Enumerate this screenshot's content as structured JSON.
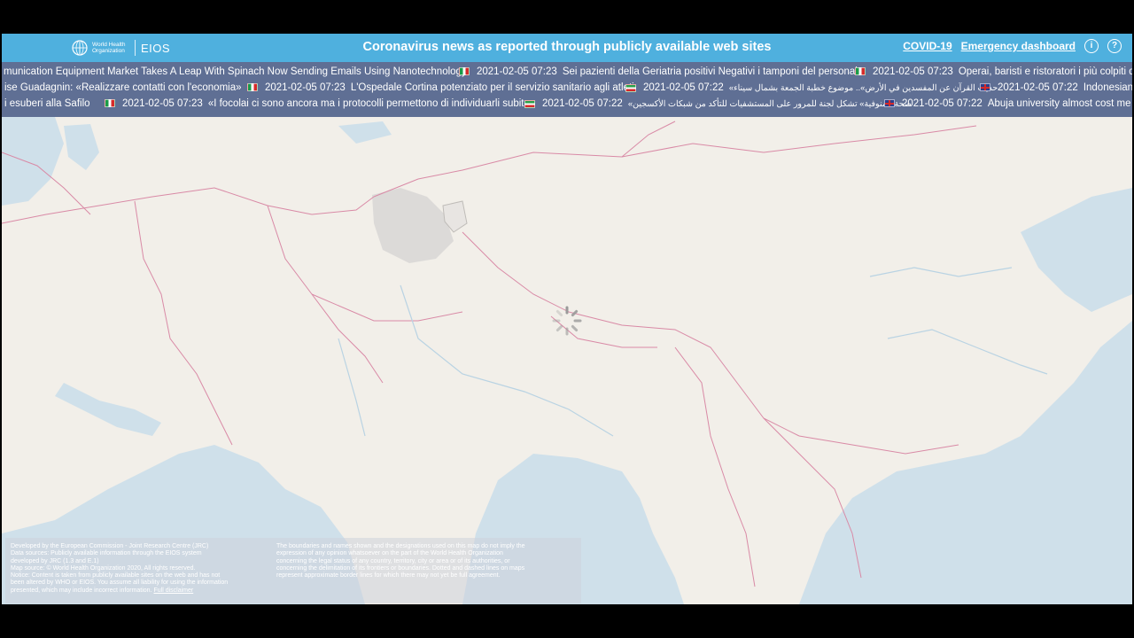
{
  "header": {
    "logo_org": "World Health Organization",
    "logo_product": "EIOS",
    "title": "Coronavirus news as reported through publicly available web sites",
    "nav": {
      "covid_link": "COVID-19",
      "emergency_link": "Emergency dashboard",
      "info_icon": "info-icon",
      "help_icon": "help-icon"
    },
    "color": "#4fb0de"
  },
  "ticker": {
    "color": "#5f6f94",
    "rows": [
      [
        {
          "flag": "",
          "time": "",
          "text": "munication Equipment Market Takes A Leap With Spinach Now Sending Emails Using Nanotechnology"
        },
        {
          "flag": "it",
          "time": "2021-02-05 07:23",
          "text": "Sei pazienti della Geriatria positivi Negativi i tamponi del personale"
        },
        {
          "flag": "it",
          "time": "2021-02-05 07:23",
          "text": "Operai, baristi e ristoratori i più colpiti dalla"
        }
      ],
      [
        {
          "flag": "",
          "time": "",
          "text": "ise Guadagnin: «Realizzare contatti con l'economia»"
        },
        {
          "flag": "it",
          "time": "2021-02-05 07:23",
          "text": "L'Ospedale Cortina potenziato per il servizio sanitario agli atleti"
        },
        {
          "flag": "ir",
          "time": "2021-02-05 07:22",
          "text": "حديث القرآن عن المفسدين في الأرض».. موضوع خطبة الجمعة بشمال سيناء»"
        },
        {
          "flag": "gb",
          "time": "2021-02-05 07:22",
          "text": "Indonesian e"
        }
      ],
      [
        {
          "flag": "",
          "time": "",
          "text": "i esuberi alla Safilo"
        },
        {
          "flag": "it",
          "time": "2021-02-05 07:23",
          "text": "«I focolai ci sono ancora ma i protocolli permettono di individuarli subito»"
        },
        {
          "flag": "ir",
          "time": "2021-02-05 07:22",
          "text": "صحة المنوفية» تشكل لجنة للمرور على المستشفيات للتأكد من شبكات الأكسجين»"
        },
        {
          "flag": "gb",
          "time": "2021-02-05 07:22",
          "text": "Abuja university almost cost me my"
        }
      ]
    ]
  },
  "map": {
    "loading_icon": "loading-spinner-icon",
    "land_color": "#f2efe9",
    "water_color": "#cfe0ea",
    "border_color": "#d98aa6"
  },
  "disclaimer": {
    "left_lines": [
      "Developed by the European Commission - Joint Research Centre (JRC)",
      "Data sources: Publicly available information through the EIOS system",
      "developed by JRC (1.3 and E.1)",
      "Map source: © World Health Organization 2020, All rights reserved.",
      "Notice: Content is taken from publicly available sites on the web and has not",
      "been altered by WHO or EIOS. You assume all liability for using the information",
      "presented, which may include incorrect information."
    ],
    "link": "Full disclaimer",
    "right_lines": [
      "The boundaries and names shown and the designations used on this map do not imply the",
      "expression of any opinion whatsoever on the part of the World Health Organization",
      "concerning the legal status of any country, territory, city or area or of its authorities, or",
      "concerning the delimitation of its frontiers or boundaries. Dotted and dashed lines on maps",
      "represent approximate border lines for which there may not yet be full agreement."
    ]
  }
}
